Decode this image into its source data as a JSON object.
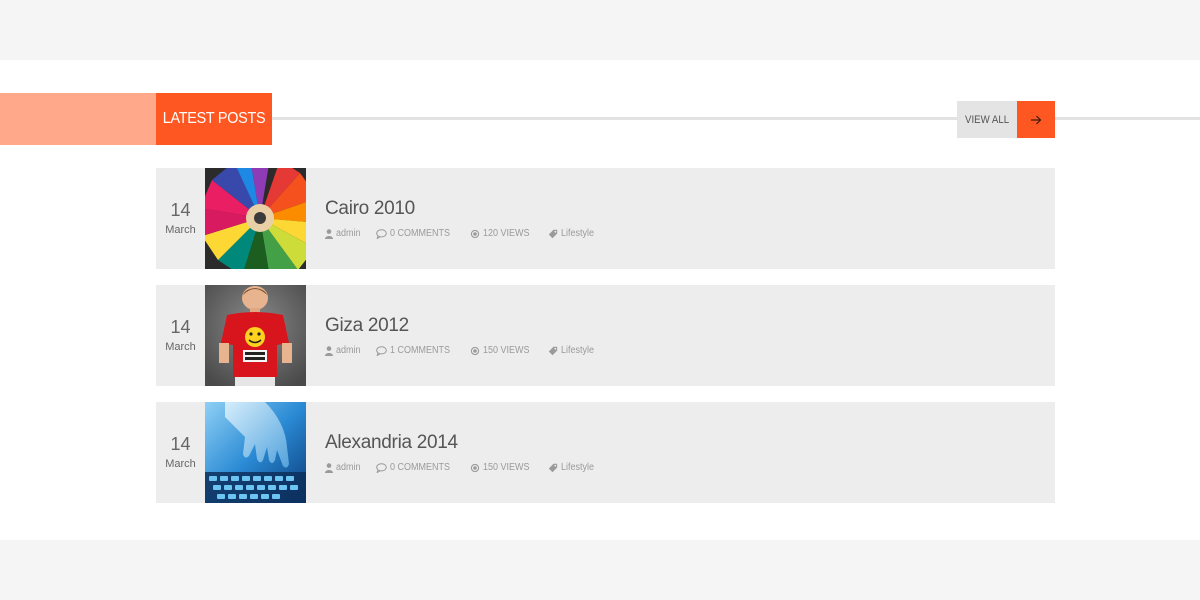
{
  "section": {
    "title": "LATEST POSTS",
    "view_all_label": "VIEW ALL",
    "view_all_icon": "arrow-right-icon"
  },
  "colors": {
    "accent": "#ff5722",
    "accent_light": "#ffa88a",
    "row_bg": "#ededed",
    "page_bg": "#f5f5f5"
  },
  "posts": [
    {
      "day": "14",
      "month": "March",
      "title": "Cairo 2010",
      "author": "admin",
      "comments": "0 COMMENTS",
      "views": "120 VIEWS",
      "category": "Lifestyle",
      "thumbnail": "colored-pencils"
    },
    {
      "day": "14",
      "month": "March",
      "title": "Giza 2012",
      "author": "admin",
      "comments": "1 COMMENTS",
      "views": "150 VIEWS",
      "category": "Lifestyle",
      "thumbnail": "boy-red-shirt"
    },
    {
      "day": "14",
      "month": "March",
      "title": "Alexandria 2014",
      "author": "admin",
      "comments": "0 COMMENTS",
      "views": "150 VIEWS",
      "category": "Lifestyle",
      "thumbnail": "hand-keyboard"
    }
  ]
}
